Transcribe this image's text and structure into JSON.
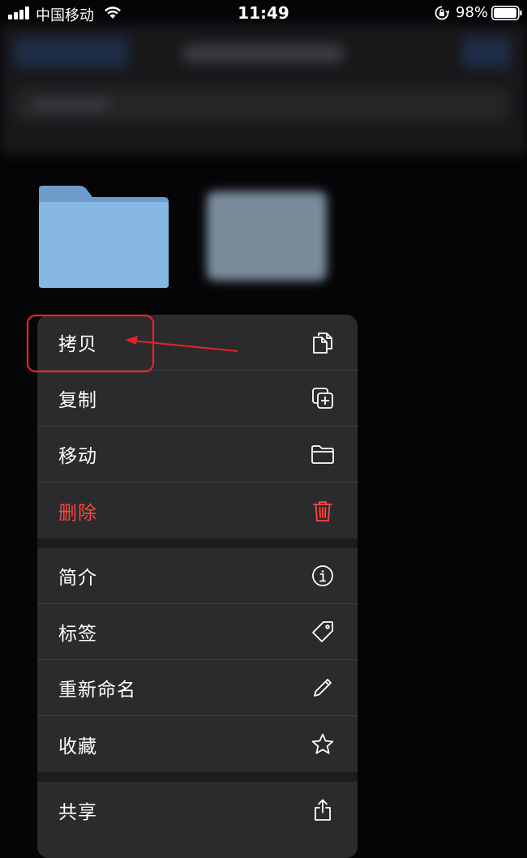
{
  "status_bar": {
    "carrier": "中国移动",
    "time": "11:49",
    "battery_percent": "98%",
    "signal_bars": 4,
    "battery_level": 0.98
  },
  "menu": {
    "groups": [
      [
        {
          "label": "拷贝",
          "icon": "copy-icon"
        },
        {
          "label": "复制",
          "icon": "duplicate-icon"
        },
        {
          "label": "移动",
          "icon": "folder-icon"
        },
        {
          "label": "删除",
          "icon": "trash-icon",
          "destructive": true
        }
      ],
      [
        {
          "label": "简介",
          "icon": "info-icon"
        },
        {
          "label": "标签",
          "icon": "tag-icon"
        },
        {
          "label": "重新命名",
          "icon": "pencil-icon"
        },
        {
          "label": "收藏",
          "icon": "star-icon"
        }
      ],
      [
        {
          "label": "共享",
          "icon": "share-icon"
        }
      ]
    ]
  },
  "colors": {
    "menu_background": "#2b2b2e",
    "destructive": "#ff453a",
    "folder_blue": "#86b8e3",
    "annotation_red": "#e0262a"
  }
}
